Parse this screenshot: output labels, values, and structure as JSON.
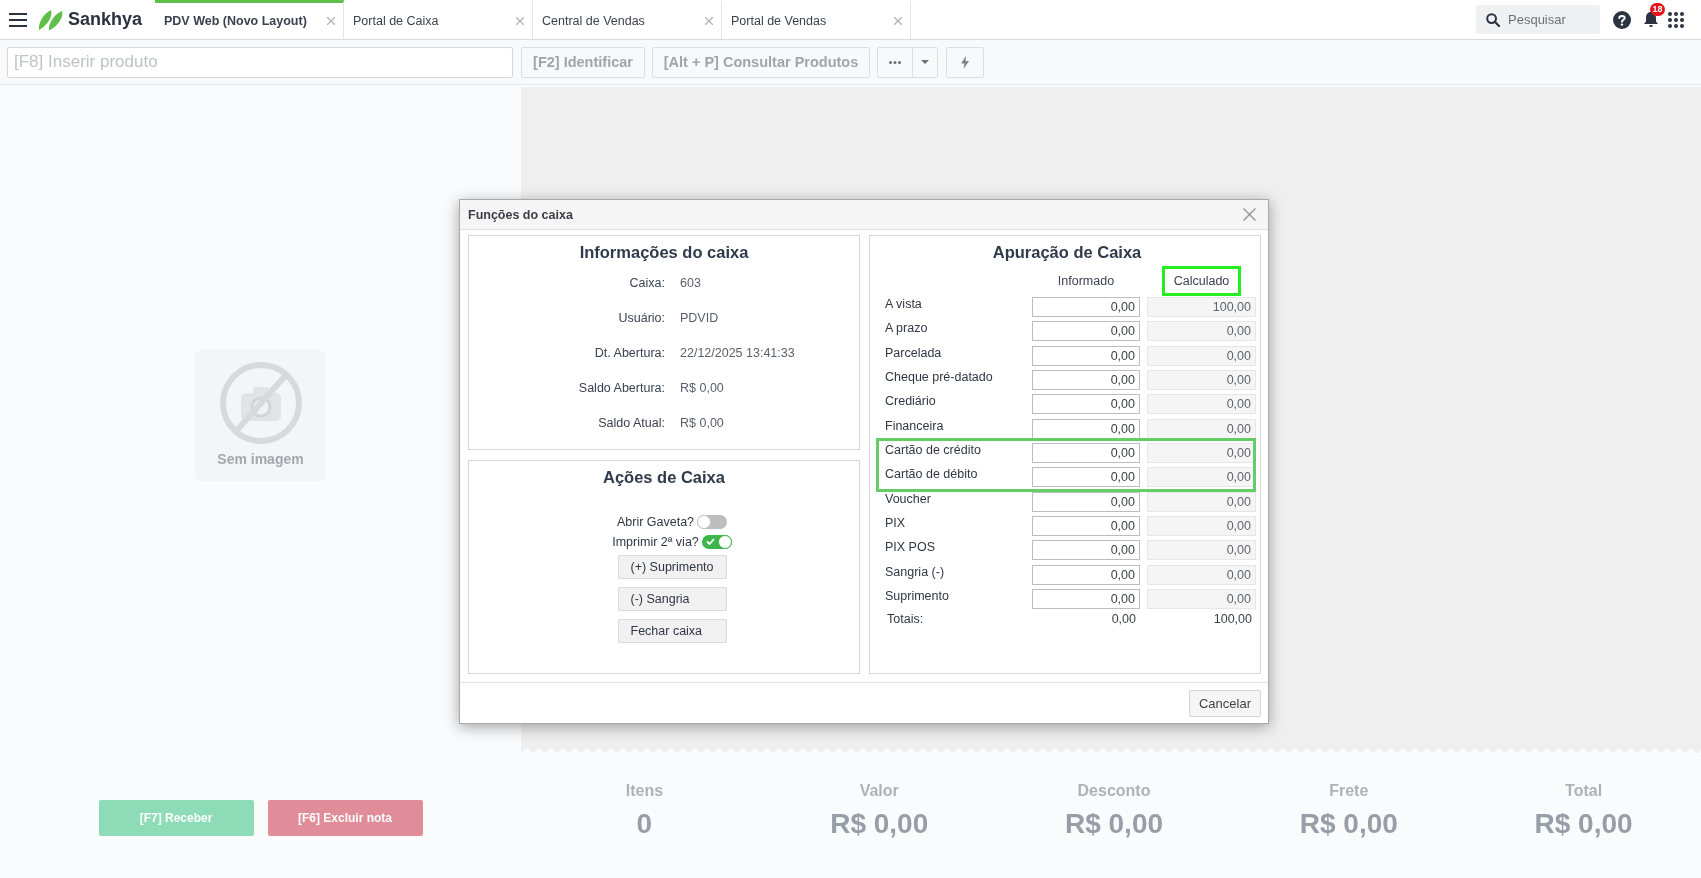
{
  "header": {
    "brand": "Sankhya",
    "tabs": [
      {
        "label": "PDV Web (Novo Layout)",
        "selected": true
      },
      {
        "label": "Portal de Caixa",
        "selected": false
      },
      {
        "label": "Central de Vendas",
        "selected": false
      },
      {
        "label": "Portal de Vendas",
        "selected": false
      }
    ],
    "search": {
      "placeholder": "Pesquisar"
    },
    "notifications": {
      "count": "18"
    }
  },
  "toolbar": {
    "product_field": {
      "placeholder": "[F8] Inserir produto"
    },
    "buttons": [
      {
        "label": "[F2] Identificar"
      },
      {
        "label": "[Alt + P] Consultar Produtos"
      }
    ]
  },
  "product_image": {
    "caption": "Sem imagem"
  },
  "note_actions": [
    {
      "label": "[F7] Receber",
      "kind": "receive",
      "disabled": true
    },
    {
      "label": "[F6] Excluir nota",
      "kind": "delete",
      "disabled": true
    }
  ],
  "summary": [
    {
      "label": "Itens",
      "value": "0"
    },
    {
      "label": "Valor",
      "value": "R$ 0,00"
    },
    {
      "label": "Desconto",
      "value": "R$ 0,00"
    },
    {
      "label": "Frete",
      "value": "R$ 0,00"
    },
    {
      "label": "Total",
      "value": "R$ 0,00"
    }
  ],
  "dialog": {
    "title": "Funções do caixa",
    "info": {
      "title": "Informações do caixa",
      "fields": [
        {
          "label": "Caixa:",
          "value": "603"
        },
        {
          "label": "Usuário:",
          "value": "PDVID"
        },
        {
          "label": "Dt. Abertura:",
          "value": "22/12/2025 13:41:33"
        },
        {
          "label": "Saldo Abertura:",
          "value": "R$ 0,00"
        },
        {
          "label": "Saldo Atual:",
          "value": "R$ 0,00"
        }
      ]
    },
    "actions": {
      "title": "Ações de Caixa",
      "toggles": [
        {
          "label": "Abrir Gaveta?",
          "on": false
        },
        {
          "label": "Imprimir 2ª via?",
          "on": true
        }
      ],
      "buttons": [
        "(+) Suprimento",
        "(-) Sangria",
        "Fechar caixa"
      ]
    },
    "tally": {
      "title": "Apuração de Caixa",
      "columns": [
        {
          "label": "Informado",
          "highlighted": false,
          "disabled": false
        },
        {
          "label": "Calculado",
          "highlighted": true,
          "disabled": true
        }
      ],
      "rows": [
        {
          "label": "A vista",
          "values": [
            "0,00",
            "100,00"
          ],
          "highlighted": false
        },
        {
          "label": "A prazo",
          "values": [
            "0,00",
            "0,00"
          ],
          "highlighted": false
        },
        {
          "label": "Parcelada",
          "values": [
            "0,00",
            "0,00"
          ],
          "highlighted": false
        },
        {
          "label": "Cheque pré-datado",
          "values": [
            "0,00",
            "0,00"
          ],
          "highlighted": false
        },
        {
          "label": "Crediário",
          "values": [
            "0,00",
            "0,00"
          ],
          "highlighted": false
        },
        {
          "label": "Financeira",
          "values": [
            "0,00",
            "0,00"
          ],
          "highlighted": false
        },
        {
          "label": "Cartão de crédito",
          "values": [
            "0,00",
            "0,00"
          ],
          "highlighted": true
        },
        {
          "label": "Cartão de débito",
          "values": [
            "0,00",
            "0,00"
          ],
          "highlighted": true
        },
        {
          "label": "Voucher",
          "values": [
            "0,00",
            "0,00"
          ],
          "highlighted": false
        },
        {
          "label": "PIX",
          "values": [
            "0,00",
            "0,00"
          ],
          "highlighted": false
        },
        {
          "label": "PIX POS",
          "values": [
            "0,00",
            "0,00"
          ],
          "highlighted": false
        },
        {
          "label": "Sangria (-)",
          "values": [
            "0,00",
            "0,00"
          ],
          "highlighted": false
        },
        {
          "label": "Suprimento",
          "values": [
            "0,00",
            "0,00"
          ],
          "highlighted": false
        }
      ],
      "totals": {
        "label": "Totais:",
        "values": [
          "0,00",
          "100,00"
        ]
      }
    },
    "buttons": [
      "Cancelar"
    ]
  }
}
